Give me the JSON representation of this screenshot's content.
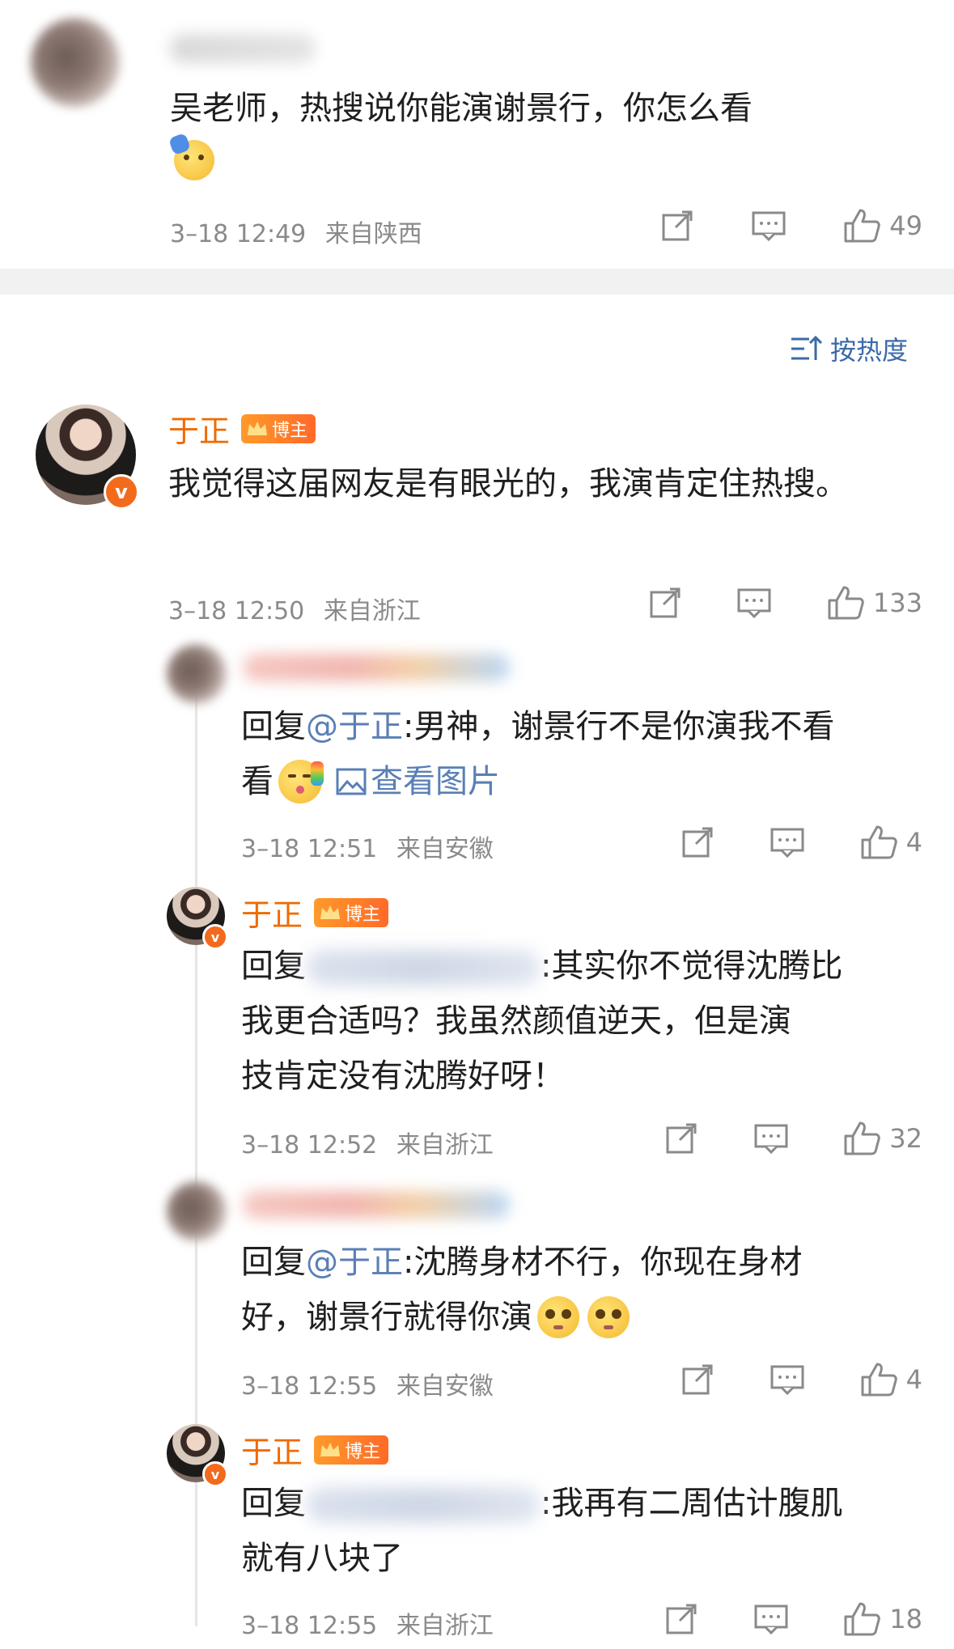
{
  "top_comment": {
    "text_line1": "吴老师，热搜说你能演谢景行，你怎么看",
    "time": "3–18 12:49",
    "location": "来自陕西",
    "likes": "49"
  },
  "sort": {
    "label": "按热度"
  },
  "main_comment": {
    "author": "于正",
    "badge": "博主",
    "text": "我觉得这届网友是有眼光的，我演肯定住热搜。",
    "time": "3–18 12:50",
    "location": "来自浙江",
    "likes": "133"
  },
  "replies": [
    {
      "prefix": "回复",
      "mention": "@于正",
      "text": ":男神，谢景行不是你演我不看",
      "line2_prefix": "看",
      "view_image": "查看图片",
      "time": "3–18 12:51",
      "location": "来自安徽",
      "likes": "4"
    },
    {
      "author": "于正",
      "badge": "博主",
      "prefix": "回复",
      "text_line1": ":其实你不觉得沈腾比",
      "text_line2": "我更合适吗？我虽然颜值逆天，但是演",
      "text_line3": "技肯定没有沈腾好呀！",
      "time": "3–18 12:52",
      "location": "来自浙江",
      "likes": "32"
    },
    {
      "prefix": "回复",
      "mention": "@于正",
      "text_line1": ":沈腾身材不行，你现在身材",
      "text_line2": "好，谢景行就得你演",
      "time": "3–18 12:55",
      "location": "来自安徽",
      "likes": "4"
    },
    {
      "author": "于正",
      "badge": "博主",
      "prefix": "回复",
      "text_line1": ":我再有二周估计腹肌",
      "text_line2": "就有八块了",
      "time": "3–18 12:55",
      "location": "来自浙江",
      "likes": "18"
    }
  ],
  "colors": {
    "accent_orange": "#f06a00",
    "link_blue": "#5a7fb5",
    "meta_grey": "#8a8a8a"
  }
}
